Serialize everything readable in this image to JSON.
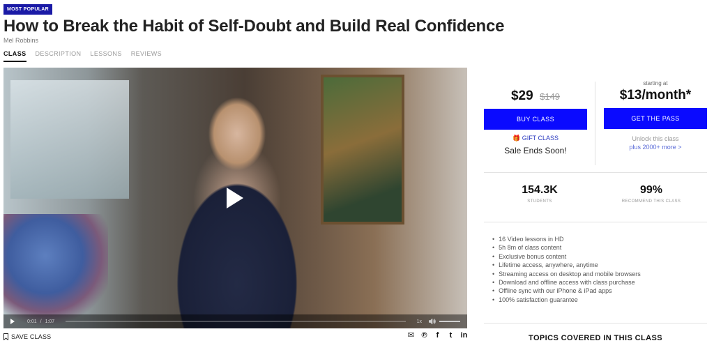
{
  "badge": "MOST POPULAR",
  "title": "How to Break the Habit of Self-Doubt and Build Real Confidence",
  "author": "Mel Robbins",
  "tabs": [
    {
      "label": "CLASS",
      "active": true
    },
    {
      "label": "DESCRIPTION",
      "active": false
    },
    {
      "label": "LESSONS",
      "active": false
    },
    {
      "label": "REVIEWS",
      "active": false
    }
  ],
  "video": {
    "current_time": "0:01",
    "separator": "/",
    "duration": "1:07",
    "speed": "1x",
    "play_icon": "play-icon",
    "volume_icon": "volume-icon"
  },
  "save_label": "SAVE CLASS",
  "share_icons": [
    "email-icon",
    "pinterest-icon",
    "facebook-icon",
    "twitter-icon",
    "linkedin-icon"
  ],
  "share_glyphs": [
    "✉",
    "℗",
    "f",
    "t",
    "in"
  ],
  "pricing": {
    "price": "$29",
    "original_price": "$149",
    "buy_label": "BUY CLASS",
    "gift_label": "GIFT CLASS",
    "sale_text": "Sale Ends Soon!",
    "starting_label": "starting at",
    "pass_price": "$13/month*",
    "pass_label": "GET THE PASS",
    "unlock_text": "Unlock this class",
    "unlock_link": "plus 2000+ more >",
    "accent_color": "#0a0aff"
  },
  "stats": {
    "students_value": "154.3K",
    "students_label": "STUDENTS",
    "recommend_value": "99%",
    "recommend_label": "RECOMMEND THIS CLASS"
  },
  "features": [
    "16 Video lessons in HD",
    "5h 8m of class content",
    "Exclusive bonus content",
    "Lifetime access, anywhere, anytime",
    "Streaming access on desktop and mobile browsers",
    "Download and offline access with class purchase",
    "Offline sync with our iPhone & iPad apps",
    "100% satisfaction guarantee"
  ],
  "topics_heading": "TOPICS COVERED IN THIS CLASS"
}
